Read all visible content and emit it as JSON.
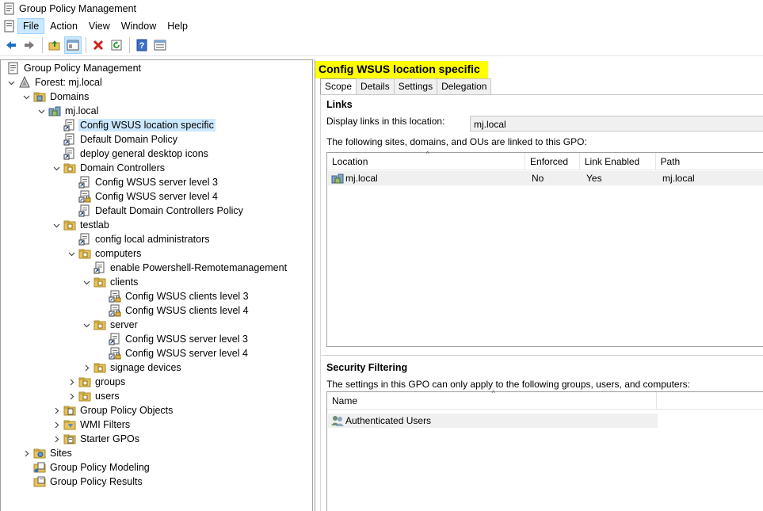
{
  "window": {
    "title": "Group Policy Management"
  },
  "menu": {
    "items": [
      "File",
      "Action",
      "View",
      "Window",
      "Help"
    ]
  },
  "toolbar": {
    "buttons": [
      "back-icon",
      "forward-icon",
      "up-folder-icon",
      "show-hide-tree-icon",
      "delete-icon",
      "refresh-icon",
      "help-icon",
      "properties-icon"
    ]
  },
  "tree": [
    {
      "label": "Group Policy Management",
      "icon": "gpm-icon",
      "depth": 0,
      "expander": ""
    },
    {
      "label": "Forest: mj.local",
      "icon": "forest-icon",
      "depth": 0,
      "expander": "v"
    },
    {
      "label": "Domains",
      "icon": "domains-folder-icon",
      "depth": 1,
      "expander": "v"
    },
    {
      "label": "mj.local",
      "icon": "domain-icon",
      "depth": 2,
      "expander": "v"
    },
    {
      "label": "Config WSUS location specific",
      "icon": "gpo-link-icon",
      "depth": 3,
      "expander": "",
      "selected": true
    },
    {
      "label": "Default Domain Policy",
      "icon": "gpo-link-icon",
      "depth": 3,
      "expander": ""
    },
    {
      "label": "deploy general desktop icons",
      "icon": "gpo-link-icon",
      "depth": 3,
      "expander": ""
    },
    {
      "label": "Domain Controllers",
      "icon": "ou-icon",
      "depth": 3,
      "expander": "v"
    },
    {
      "label": "Config WSUS server level 3",
      "icon": "gpo-link-icon",
      "depth": 4,
      "expander": ""
    },
    {
      "label": "Config WSUS server level 4",
      "icon": "gpo-link-locked-icon",
      "depth": 4,
      "expander": ""
    },
    {
      "label": "Default Domain Controllers Policy",
      "icon": "gpo-link-icon",
      "depth": 4,
      "expander": ""
    },
    {
      "label": "testlab",
      "icon": "ou-icon",
      "depth": 3,
      "expander": "v"
    },
    {
      "label": "config local administrators",
      "icon": "gpo-link-icon",
      "depth": 4,
      "expander": ""
    },
    {
      "label": "computers",
      "icon": "ou-icon",
      "depth": 4,
      "expander": "v"
    },
    {
      "label": "enable Powershell-Remotemanagement",
      "icon": "gpo-link-icon",
      "depth": 5,
      "expander": ""
    },
    {
      "label": "clients",
      "icon": "ou-icon",
      "depth": 5,
      "expander": "v"
    },
    {
      "label": "Config WSUS clients level 3",
      "icon": "gpo-link-locked-icon",
      "depth": 6,
      "expander": ""
    },
    {
      "label": "Config WSUS clients level 4",
      "icon": "gpo-link-locked-icon",
      "depth": 6,
      "expander": ""
    },
    {
      "label": "server",
      "icon": "ou-icon",
      "depth": 5,
      "expander": "v"
    },
    {
      "label": "Config WSUS server level 3",
      "icon": "gpo-link-icon",
      "depth": 6,
      "expander": ""
    },
    {
      "label": "Config WSUS server level 4",
      "icon": "gpo-link-locked-icon",
      "depth": 6,
      "expander": ""
    },
    {
      "label": "signage devices",
      "icon": "ou-icon",
      "depth": 5,
      "expander": ">"
    },
    {
      "label": "groups",
      "icon": "ou-icon",
      "depth": 4,
      "expander": ">"
    },
    {
      "label": "users",
      "icon": "ou-icon",
      "depth": 4,
      "expander": ">"
    },
    {
      "label": "Group Policy Objects",
      "icon": "gpo-folder-icon",
      "depth": 3,
      "expander": ">"
    },
    {
      "label": "WMI Filters",
      "icon": "wmi-folder-icon",
      "depth": 3,
      "expander": ">"
    },
    {
      "label": "Starter GPOs",
      "icon": "starter-folder-icon",
      "depth": 3,
      "expander": ">"
    },
    {
      "label": "Sites",
      "icon": "sites-folder-icon",
      "depth": 1,
      "expander": ">"
    },
    {
      "label": "Group Policy Modeling",
      "icon": "modeling-icon",
      "depth": 1,
      "expander": ""
    },
    {
      "label": "Group Policy Results",
      "icon": "results-icon",
      "depth": 1,
      "expander": ""
    }
  ],
  "detail": {
    "title": "Config WSUS location specific",
    "tabs": [
      "Scope",
      "Details",
      "Settings",
      "Delegation"
    ],
    "active_tab": "Scope",
    "links": {
      "heading": "Links",
      "display_label": "Display links in this location:",
      "display_value": "mj.local",
      "description": "The following sites, domains, and OUs are linked to this GPO:",
      "columns": [
        "Location",
        "Enforced",
        "Link Enabled",
        "Path"
      ],
      "rows": [
        {
          "location": "mj.local",
          "enforced": "No",
          "link_enabled": "Yes",
          "path": "mj.local"
        }
      ]
    },
    "security": {
      "heading": "Security Filtering",
      "description": "The settings in this GPO can only apply to the following groups, users, and computers:",
      "columns": [
        "Name"
      ],
      "rows": [
        {
          "name": "Authenticated Users"
        }
      ]
    }
  }
}
